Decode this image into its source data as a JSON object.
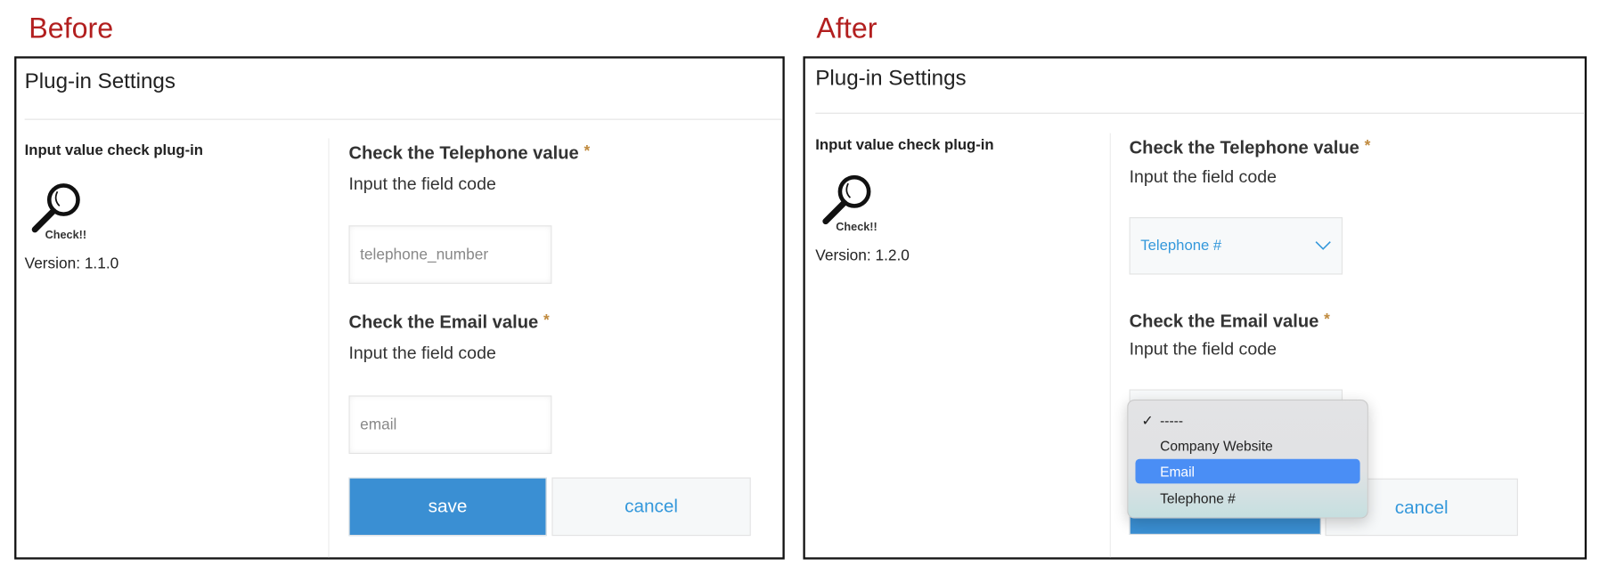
{
  "before": {
    "caption": "Before",
    "window_title": "Plug-in Settings",
    "plugin_name": "Input value check plug-in",
    "plugin_icon": "magnifier-check-logo",
    "version": "Version: 1.1.0",
    "telephone": {
      "heading": "Check the Telephone value",
      "required": "*",
      "subtext": "Input the field code",
      "value": "telephone_number"
    },
    "email": {
      "heading": "Check the Email value",
      "required": "*",
      "subtext": "Input the field code",
      "value": "email"
    },
    "save_label": "save",
    "cancel_label": "cancel"
  },
  "after": {
    "caption": "After",
    "window_title": "Plug-in Settings",
    "plugin_name": "Input value check plug-in",
    "plugin_icon": "magnifier-check-logo",
    "version": "Version: 1.2.0",
    "telephone": {
      "heading": "Check the Telephone value",
      "required": "*",
      "subtext": "Input the field code",
      "selected": "Telephone #"
    },
    "email": {
      "heading": "Check the Email value",
      "required": "*",
      "subtext": "Input the field code"
    },
    "dropdown": {
      "options": [
        {
          "label": "-----",
          "checked": true
        },
        {
          "label": "Company Website"
        },
        {
          "label": "Email",
          "highlighted": true
        },
        {
          "label": "Telephone #"
        }
      ]
    },
    "cancel_label": "cancel"
  },
  "colors": {
    "caption": "#b21f1f",
    "primary": "#3a8fd3",
    "link": "#3498db",
    "required": "#c08a3e",
    "highlight": "#4a8ef5"
  }
}
